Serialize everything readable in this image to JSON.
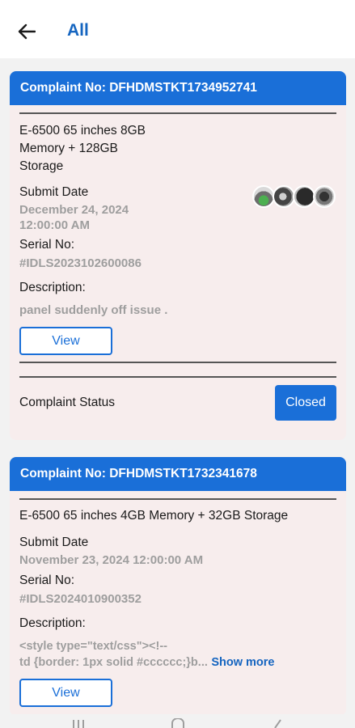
{
  "header": {
    "title": "All",
    "back_icon": "arrow-left-icon"
  },
  "complaints": [
    {
      "header": "Complaint No: DFHDMSTKT1734952741",
      "product_lines": [
        "E-6500 65 inches 8GB",
        "Memory + 128GB",
        "Storage"
      ],
      "submit_label": "Submit Date",
      "submit_lines": [
        "December 24, 2024",
        "12:00:00 AM"
      ],
      "serial_label": "Serial No:",
      "serial": "#IDLS2023102600086",
      "description_label": "Description:",
      "description": "panel suddenly off issue .",
      "view_label": "View",
      "status_label": "Complaint Status",
      "status": "Closed"
    },
    {
      "header": "Complaint No: DFHDMSTKT1732341678",
      "product": "E-6500 65 inches 4GB Memory + 32GB Storage",
      "submit_label": "Submit Date",
      "submit_date": "November 23, 2024 12:00:00 AM",
      "serial_label": "Serial No:",
      "serial": "#IDLS2024010900352",
      "description_label": "Description:",
      "description_lines": [
        "<style type=\"text/css\"><!--",
        "td {border: 1px solid #cccccc;}b..."
      ],
      "show_more": "Show more",
      "view_label": "View"
    }
  ],
  "colors": {
    "primary": "#1a6fd8",
    "card_bg": "#f7eded",
    "muted_text": "#9e9e9e"
  }
}
